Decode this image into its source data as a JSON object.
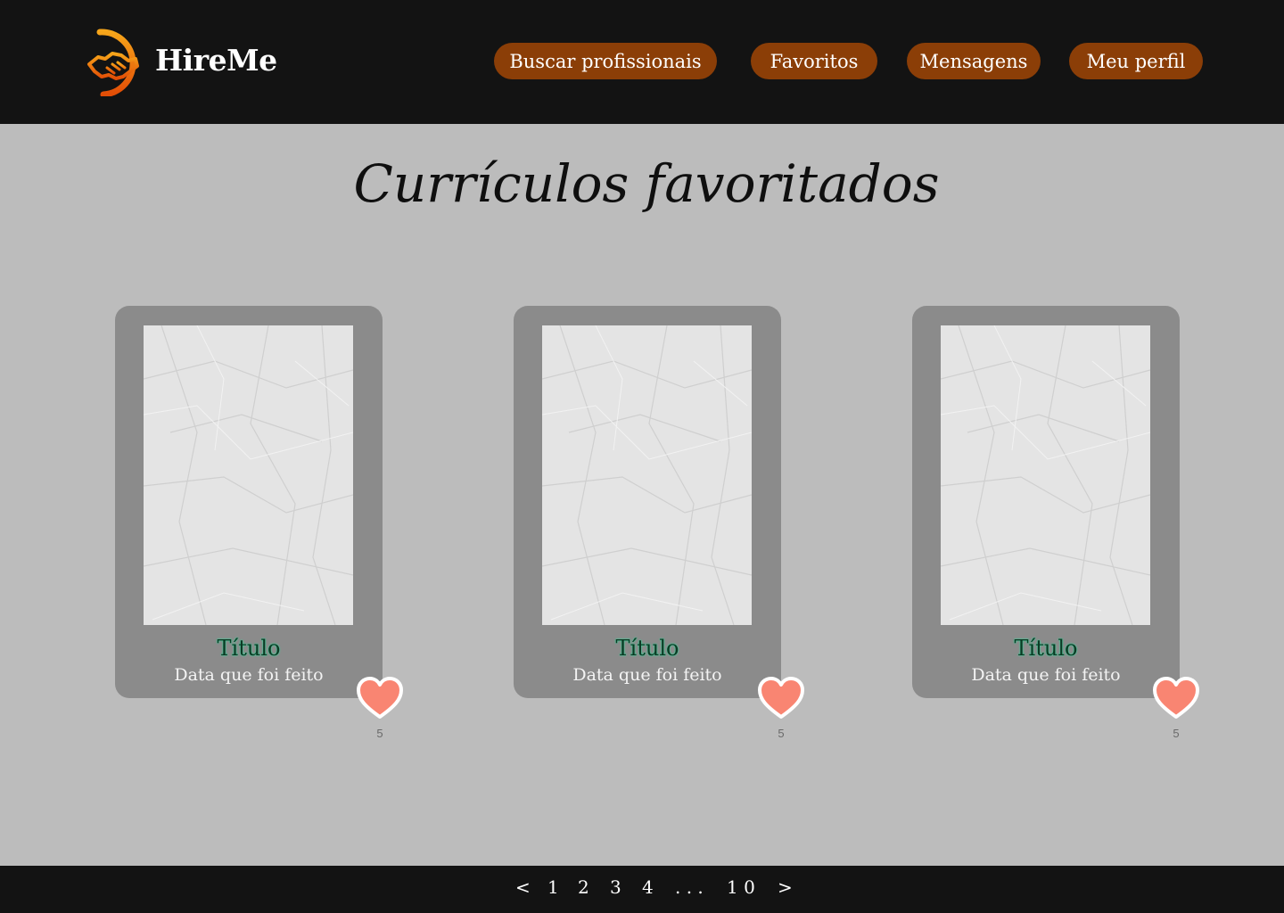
{
  "brand": {
    "name": "HireMe",
    "icon": "handshake-icon",
    "accent_color": "#f39a11"
  },
  "nav": {
    "items": [
      {
        "label": "Buscar profissionais"
      },
      {
        "label": "Favoritos"
      },
      {
        "label": "Mensagens"
      },
      {
        "label": "Meu perfil"
      }
    ],
    "button_color": "#8b3e07"
  },
  "page": {
    "title": "Currículos favoritados"
  },
  "cards": [
    {
      "title": "Título",
      "date": "Data que foi feito",
      "likes": "5"
    },
    {
      "title": "Título",
      "date": "Data que foi feito",
      "likes": "5"
    },
    {
      "title": "Título",
      "date": "Data que foi feito",
      "likes": "5"
    }
  ],
  "favorite": {
    "icon": "heart-icon",
    "color": "#f98572"
  },
  "pagination": {
    "prev": "<",
    "pages": [
      "1",
      "2",
      "3",
      "4"
    ],
    "ellipsis": ". . .",
    "last": "1 0",
    "next": ">"
  }
}
